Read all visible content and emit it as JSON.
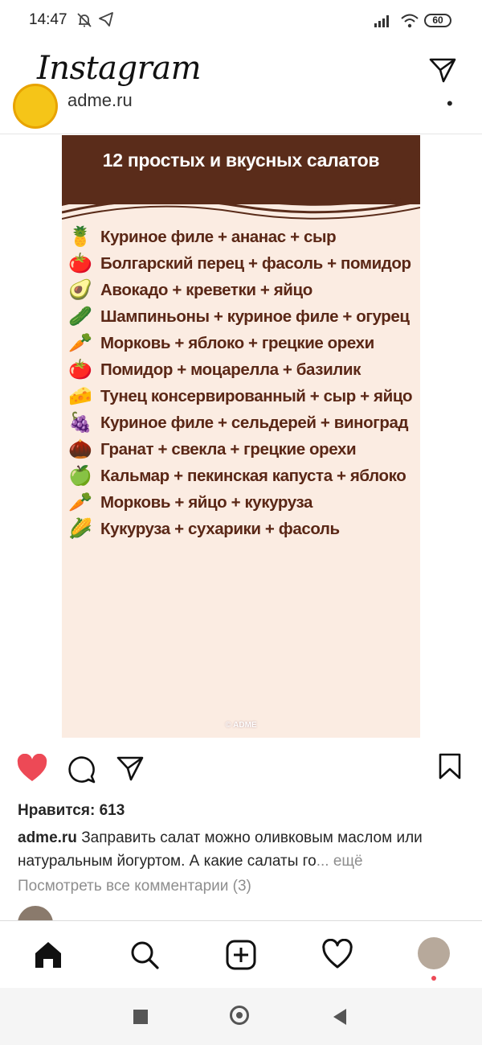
{
  "status_bar": {
    "time": "14:47",
    "battery": "60"
  },
  "header": {
    "logo": "Instagram"
  },
  "post": {
    "author": "adme.ru",
    "image": {
      "title": "12 простых и вкусных салатов",
      "items": [
        {
          "icon": "🍍",
          "text": "Куриное филе + ананас + сыр"
        },
        {
          "icon": "🍅",
          "text": "Болгарский перец + фасоль + помидор"
        },
        {
          "icon": "🥑",
          "text": "Авокадо + креветки + яйцо"
        },
        {
          "icon": "🥒",
          "text": "Шампиньоны + куриное филе + огурец"
        },
        {
          "icon": "🥕",
          "text": "Морковь + яблоко + грецкие орехи"
        },
        {
          "icon": "🍅",
          "text": "Помидор + моцарелла + базилик"
        },
        {
          "icon": "🧀",
          "text": "Тунец консервированный + сыр + яйцо"
        },
        {
          "icon": "🍇",
          "text": "Куриное филе + сельдерей + виноград"
        },
        {
          "icon": "🌰",
          "text": "Гранат + свекла + грецкие орехи"
        },
        {
          "icon": "🍏",
          "text": "Кальмар + пекинская капуста + яблоко"
        },
        {
          "icon": "🥕",
          "text": "Морковь + яйцо + кукуруза"
        },
        {
          "icon": "🌽",
          "text": "Кукуруза + сухарики + фасоль"
        }
      ],
      "watermark": "© ADME"
    },
    "likes_label": "Нравится: 613",
    "caption_author": "adme.ru",
    "caption_text": " Заправить салат можно оливковым маслом или натуральным йогуртом. А какие салаты го",
    "caption_more": "... ещё",
    "view_comments": "Посмотреть все комментарии (3)"
  },
  "colors": {
    "like_red": "#ed4956",
    "post_header_brown": "#5a2c1a",
    "post_bg": "#fbece2",
    "post_text": "#5a2716"
  }
}
